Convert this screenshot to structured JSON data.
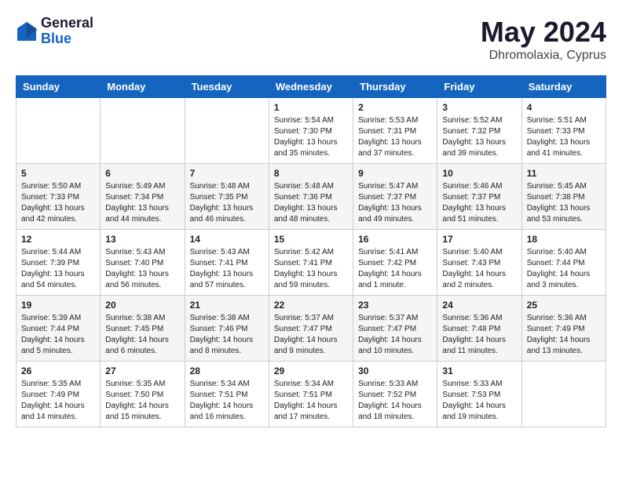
{
  "logo": {
    "general": "General",
    "blue": "Blue"
  },
  "header": {
    "month": "May 2024",
    "location": "Dhromolaxia, Cyprus"
  },
  "weekdays": [
    "Sunday",
    "Monday",
    "Tuesday",
    "Wednesday",
    "Thursday",
    "Friday",
    "Saturday"
  ],
  "weeks": [
    [
      {
        "day": "",
        "info": ""
      },
      {
        "day": "",
        "info": ""
      },
      {
        "day": "",
        "info": ""
      },
      {
        "day": "1",
        "info": "Sunrise: 5:54 AM\nSunset: 7:30 PM\nDaylight: 13 hours\nand 35 minutes."
      },
      {
        "day": "2",
        "info": "Sunrise: 5:53 AM\nSunset: 7:31 PM\nDaylight: 13 hours\nand 37 minutes."
      },
      {
        "day": "3",
        "info": "Sunrise: 5:52 AM\nSunset: 7:32 PM\nDaylight: 13 hours\nand 39 minutes."
      },
      {
        "day": "4",
        "info": "Sunrise: 5:51 AM\nSunset: 7:33 PM\nDaylight: 13 hours\nand 41 minutes."
      }
    ],
    [
      {
        "day": "5",
        "info": "Sunrise: 5:50 AM\nSunset: 7:33 PM\nDaylight: 13 hours\nand 42 minutes."
      },
      {
        "day": "6",
        "info": "Sunrise: 5:49 AM\nSunset: 7:34 PM\nDaylight: 13 hours\nand 44 minutes."
      },
      {
        "day": "7",
        "info": "Sunrise: 5:48 AM\nSunset: 7:35 PM\nDaylight: 13 hours\nand 46 minutes."
      },
      {
        "day": "8",
        "info": "Sunrise: 5:48 AM\nSunset: 7:36 PM\nDaylight: 13 hours\nand 48 minutes."
      },
      {
        "day": "9",
        "info": "Sunrise: 5:47 AM\nSunset: 7:37 PM\nDaylight: 13 hours\nand 49 minutes."
      },
      {
        "day": "10",
        "info": "Sunrise: 5:46 AM\nSunset: 7:37 PM\nDaylight: 13 hours\nand 51 minutes."
      },
      {
        "day": "11",
        "info": "Sunrise: 5:45 AM\nSunset: 7:38 PM\nDaylight: 13 hours\nand 53 minutes."
      }
    ],
    [
      {
        "day": "12",
        "info": "Sunrise: 5:44 AM\nSunset: 7:39 PM\nDaylight: 13 hours\nand 54 minutes."
      },
      {
        "day": "13",
        "info": "Sunrise: 5:43 AM\nSunset: 7:40 PM\nDaylight: 13 hours\nand 56 minutes."
      },
      {
        "day": "14",
        "info": "Sunrise: 5:43 AM\nSunset: 7:41 PM\nDaylight: 13 hours\nand 57 minutes."
      },
      {
        "day": "15",
        "info": "Sunrise: 5:42 AM\nSunset: 7:41 PM\nDaylight: 13 hours\nand 59 minutes."
      },
      {
        "day": "16",
        "info": "Sunrise: 5:41 AM\nSunset: 7:42 PM\nDaylight: 14 hours\nand 1 minute."
      },
      {
        "day": "17",
        "info": "Sunrise: 5:40 AM\nSunset: 7:43 PM\nDaylight: 14 hours\nand 2 minutes."
      },
      {
        "day": "18",
        "info": "Sunrise: 5:40 AM\nSunset: 7:44 PM\nDaylight: 14 hours\nand 3 minutes."
      }
    ],
    [
      {
        "day": "19",
        "info": "Sunrise: 5:39 AM\nSunset: 7:44 PM\nDaylight: 14 hours\nand 5 minutes."
      },
      {
        "day": "20",
        "info": "Sunrise: 5:38 AM\nSunset: 7:45 PM\nDaylight: 14 hours\nand 6 minutes."
      },
      {
        "day": "21",
        "info": "Sunrise: 5:38 AM\nSunset: 7:46 PM\nDaylight: 14 hours\nand 8 minutes."
      },
      {
        "day": "22",
        "info": "Sunrise: 5:37 AM\nSunset: 7:47 PM\nDaylight: 14 hours\nand 9 minutes."
      },
      {
        "day": "23",
        "info": "Sunrise: 5:37 AM\nSunset: 7:47 PM\nDaylight: 14 hours\nand 10 minutes."
      },
      {
        "day": "24",
        "info": "Sunrise: 5:36 AM\nSunset: 7:48 PM\nDaylight: 14 hours\nand 11 minutes."
      },
      {
        "day": "25",
        "info": "Sunrise: 5:36 AM\nSunset: 7:49 PM\nDaylight: 14 hours\nand 13 minutes."
      }
    ],
    [
      {
        "day": "26",
        "info": "Sunrise: 5:35 AM\nSunset: 7:49 PM\nDaylight: 14 hours\nand 14 minutes."
      },
      {
        "day": "27",
        "info": "Sunrise: 5:35 AM\nSunset: 7:50 PM\nDaylight: 14 hours\nand 15 minutes."
      },
      {
        "day": "28",
        "info": "Sunrise: 5:34 AM\nSunset: 7:51 PM\nDaylight: 14 hours\nand 16 minutes."
      },
      {
        "day": "29",
        "info": "Sunrise: 5:34 AM\nSunset: 7:51 PM\nDaylight: 14 hours\nand 17 minutes."
      },
      {
        "day": "30",
        "info": "Sunrise: 5:33 AM\nSunset: 7:52 PM\nDaylight: 14 hours\nand 18 minutes."
      },
      {
        "day": "31",
        "info": "Sunrise: 5:33 AM\nSunset: 7:53 PM\nDaylight: 14 hours\nand 19 minutes."
      },
      {
        "day": "",
        "info": ""
      }
    ]
  ]
}
